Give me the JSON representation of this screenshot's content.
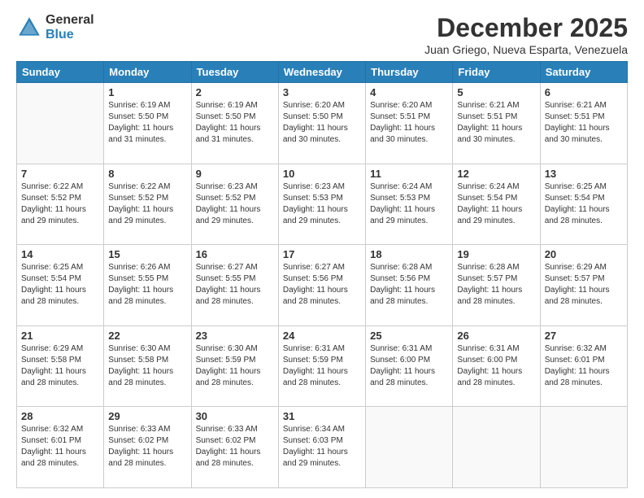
{
  "logo": {
    "general": "General",
    "blue": "Blue"
  },
  "title": "December 2025",
  "location": "Juan Griego, Nueva Esparta, Venezuela",
  "days_header": [
    "Sunday",
    "Monday",
    "Tuesday",
    "Wednesday",
    "Thursday",
    "Friday",
    "Saturday"
  ],
  "weeks": [
    [
      {
        "day": "",
        "info": ""
      },
      {
        "day": "1",
        "info": "Sunrise: 6:19 AM\nSunset: 5:50 PM\nDaylight: 11 hours\nand 31 minutes."
      },
      {
        "day": "2",
        "info": "Sunrise: 6:19 AM\nSunset: 5:50 PM\nDaylight: 11 hours\nand 31 minutes."
      },
      {
        "day": "3",
        "info": "Sunrise: 6:20 AM\nSunset: 5:50 PM\nDaylight: 11 hours\nand 30 minutes."
      },
      {
        "day": "4",
        "info": "Sunrise: 6:20 AM\nSunset: 5:51 PM\nDaylight: 11 hours\nand 30 minutes."
      },
      {
        "day": "5",
        "info": "Sunrise: 6:21 AM\nSunset: 5:51 PM\nDaylight: 11 hours\nand 30 minutes."
      },
      {
        "day": "6",
        "info": "Sunrise: 6:21 AM\nSunset: 5:51 PM\nDaylight: 11 hours\nand 30 minutes."
      }
    ],
    [
      {
        "day": "7",
        "info": "Sunrise: 6:22 AM\nSunset: 5:52 PM\nDaylight: 11 hours\nand 29 minutes."
      },
      {
        "day": "8",
        "info": "Sunrise: 6:22 AM\nSunset: 5:52 PM\nDaylight: 11 hours\nand 29 minutes."
      },
      {
        "day": "9",
        "info": "Sunrise: 6:23 AM\nSunset: 5:52 PM\nDaylight: 11 hours\nand 29 minutes."
      },
      {
        "day": "10",
        "info": "Sunrise: 6:23 AM\nSunset: 5:53 PM\nDaylight: 11 hours\nand 29 minutes."
      },
      {
        "day": "11",
        "info": "Sunrise: 6:24 AM\nSunset: 5:53 PM\nDaylight: 11 hours\nand 29 minutes."
      },
      {
        "day": "12",
        "info": "Sunrise: 6:24 AM\nSunset: 5:54 PM\nDaylight: 11 hours\nand 29 minutes."
      },
      {
        "day": "13",
        "info": "Sunrise: 6:25 AM\nSunset: 5:54 PM\nDaylight: 11 hours\nand 28 minutes."
      }
    ],
    [
      {
        "day": "14",
        "info": "Sunrise: 6:25 AM\nSunset: 5:54 PM\nDaylight: 11 hours\nand 28 minutes."
      },
      {
        "day": "15",
        "info": "Sunrise: 6:26 AM\nSunset: 5:55 PM\nDaylight: 11 hours\nand 28 minutes."
      },
      {
        "day": "16",
        "info": "Sunrise: 6:27 AM\nSunset: 5:55 PM\nDaylight: 11 hours\nand 28 minutes."
      },
      {
        "day": "17",
        "info": "Sunrise: 6:27 AM\nSunset: 5:56 PM\nDaylight: 11 hours\nand 28 minutes."
      },
      {
        "day": "18",
        "info": "Sunrise: 6:28 AM\nSunset: 5:56 PM\nDaylight: 11 hours\nand 28 minutes."
      },
      {
        "day": "19",
        "info": "Sunrise: 6:28 AM\nSunset: 5:57 PM\nDaylight: 11 hours\nand 28 minutes."
      },
      {
        "day": "20",
        "info": "Sunrise: 6:29 AM\nSunset: 5:57 PM\nDaylight: 11 hours\nand 28 minutes."
      }
    ],
    [
      {
        "day": "21",
        "info": "Sunrise: 6:29 AM\nSunset: 5:58 PM\nDaylight: 11 hours\nand 28 minutes."
      },
      {
        "day": "22",
        "info": "Sunrise: 6:30 AM\nSunset: 5:58 PM\nDaylight: 11 hours\nand 28 minutes."
      },
      {
        "day": "23",
        "info": "Sunrise: 6:30 AM\nSunset: 5:59 PM\nDaylight: 11 hours\nand 28 minutes."
      },
      {
        "day": "24",
        "info": "Sunrise: 6:31 AM\nSunset: 5:59 PM\nDaylight: 11 hours\nand 28 minutes."
      },
      {
        "day": "25",
        "info": "Sunrise: 6:31 AM\nSunset: 6:00 PM\nDaylight: 11 hours\nand 28 minutes."
      },
      {
        "day": "26",
        "info": "Sunrise: 6:31 AM\nSunset: 6:00 PM\nDaylight: 11 hours\nand 28 minutes."
      },
      {
        "day": "27",
        "info": "Sunrise: 6:32 AM\nSunset: 6:01 PM\nDaylight: 11 hours\nand 28 minutes."
      }
    ],
    [
      {
        "day": "28",
        "info": "Sunrise: 6:32 AM\nSunset: 6:01 PM\nDaylight: 11 hours\nand 28 minutes."
      },
      {
        "day": "29",
        "info": "Sunrise: 6:33 AM\nSunset: 6:02 PM\nDaylight: 11 hours\nand 28 minutes."
      },
      {
        "day": "30",
        "info": "Sunrise: 6:33 AM\nSunset: 6:02 PM\nDaylight: 11 hours\nand 28 minutes."
      },
      {
        "day": "31",
        "info": "Sunrise: 6:34 AM\nSunset: 6:03 PM\nDaylight: 11 hours\nand 29 minutes."
      },
      {
        "day": "",
        "info": ""
      },
      {
        "day": "",
        "info": ""
      },
      {
        "day": "",
        "info": ""
      }
    ]
  ]
}
